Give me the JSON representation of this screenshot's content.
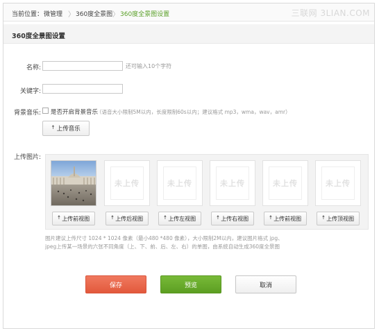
{
  "breadcrumb": {
    "prefix": "当前位置：",
    "items": [
      "微管理",
      "360度全景图",
      "360度全景图设置"
    ],
    "separator": "〉"
  },
  "watermark": "三联网 3LIAN.COM",
  "section_title": "360度全景图设置",
  "form": {
    "name_label": "名称:",
    "name_value": "",
    "name_hint": "还可输入10个字符",
    "keyword_label": "关键字:",
    "keyword_value": "",
    "music_label": "背景音乐:",
    "music_checkbox_text": "是否开启背景音乐",
    "music_tip": "（语音大小限制5M以内，长度限制60s以内；建议格式 mp3，wma，wav，amr）",
    "music_checked": false,
    "upload_music_label": "上传音乐",
    "images_label": "上传图片:"
  },
  "image_slots": [
    {
      "button": "上传前视图",
      "uploaded": true,
      "placeholder": ""
    },
    {
      "button": "上传后视图",
      "uploaded": false,
      "placeholder": "未上传"
    },
    {
      "button": "上传左视图",
      "uploaded": false,
      "placeholder": "未上传"
    },
    {
      "button": "上传右视图",
      "uploaded": false,
      "placeholder": "未上传"
    },
    {
      "button": "上传前视图",
      "uploaded": false,
      "placeholder": "未上传"
    },
    {
      "button": "上传顶视图",
      "uploaded": false,
      "placeholder": "未上传"
    }
  ],
  "notes": [
    "图片建议上传尺寸 1024 * 1024 像素（最小480 *480 像素），大小限制2M以内，建议图片格式 jpg、",
    "jpeg上传某一场景的六张不同角度（上、下、前、后、左、右）的单图，由系统自动生成360度全景图"
  ],
  "actions": {
    "save": "保存",
    "preview": "预览",
    "cancel": "取消"
  },
  "colors": {
    "accent_green": "#5aa028",
    "save": "#e2593c",
    "preview": "#5c9e22"
  },
  "icons": {
    "upload": "arrow-up-icon",
    "breadcrumb_sep": "chevron-right-icon"
  }
}
